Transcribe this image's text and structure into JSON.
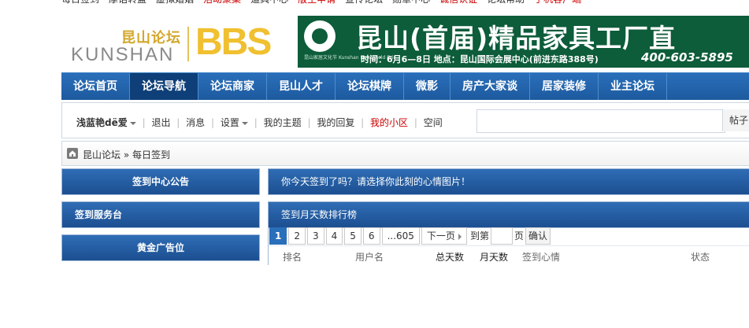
{
  "top_links": [
    {
      "label": "每日签到",
      "red": false
    },
    {
      "label": "摩话转盘",
      "red": false
    },
    {
      "label": "虚拟婚姻",
      "red": false
    },
    {
      "label": "活动聚集",
      "red": true
    },
    {
      "label": "道具中心",
      "red": false
    },
    {
      "label": "版主申请",
      "red": true
    },
    {
      "label": "宣传论坛",
      "red": false
    },
    {
      "label": "勋章中心",
      "red": false
    },
    {
      "label": "诚信认证",
      "red": true
    },
    {
      "label": "论坛帮助",
      "red": false
    },
    {
      "label": "手机客户端",
      "red": true
    }
  ],
  "logo": {
    "cn": "昆山论坛",
    "en": "KUNSHAN",
    "bbs": "BBS"
  },
  "banner": {
    "org": "昆山家居文化节",
    "org_en": "Kunshan Household Fair",
    "title": "昆山(首届)精品家具工厂直",
    "info": "时间：6月6—8日   地点：昆山国际会展中心(前进东路388号)",
    "phone": "400-603-5895"
  },
  "nav": {
    "items": [
      "论坛首页",
      "论坛导航",
      "论坛商家",
      "昆山人才",
      "论坛棋牌",
      "微影",
      "房产大家谈",
      "居家装修",
      "业主论坛"
    ],
    "active_index": 1
  },
  "userbar": {
    "username": "浅蓝艳dё爱",
    "logout": "退出",
    "messages": "消息",
    "settings": "设置",
    "my_topics": "我的主题",
    "my_replies": "我的回复",
    "my_community": "我的小区",
    "space": "空间",
    "search_placeholder": "",
    "search_type": "帖子"
  },
  "breadcrumb": {
    "home": "昆山论坛",
    "separator": "»",
    "current": "每日签到"
  },
  "sidebar": {
    "notice": "签到中心公告",
    "service": "签到服务台",
    "ad": "黄金广告位"
  },
  "main": {
    "question": "你今天签到了吗？请选择你此刻的心情图片！",
    "ranking_title": "签到月天数排行榜",
    "pager": {
      "pages": [
        "1",
        "2",
        "3",
        "4",
        "5",
        "6",
        "...605"
      ],
      "current": "1",
      "next": "下一页",
      "goto_label": "到第",
      "page_suffix": "页",
      "confirm": "确认"
    },
    "columns": [
      "排名",
      "用户名",
      "总天数",
      "月天数",
      "签到心情",
      "状态"
    ]
  },
  "colors": {
    "nav_blue": "#2a6fba",
    "banner_green": "#0d5c3a",
    "logo_gold": "#f0c030",
    "link_red": "#cc0000"
  }
}
